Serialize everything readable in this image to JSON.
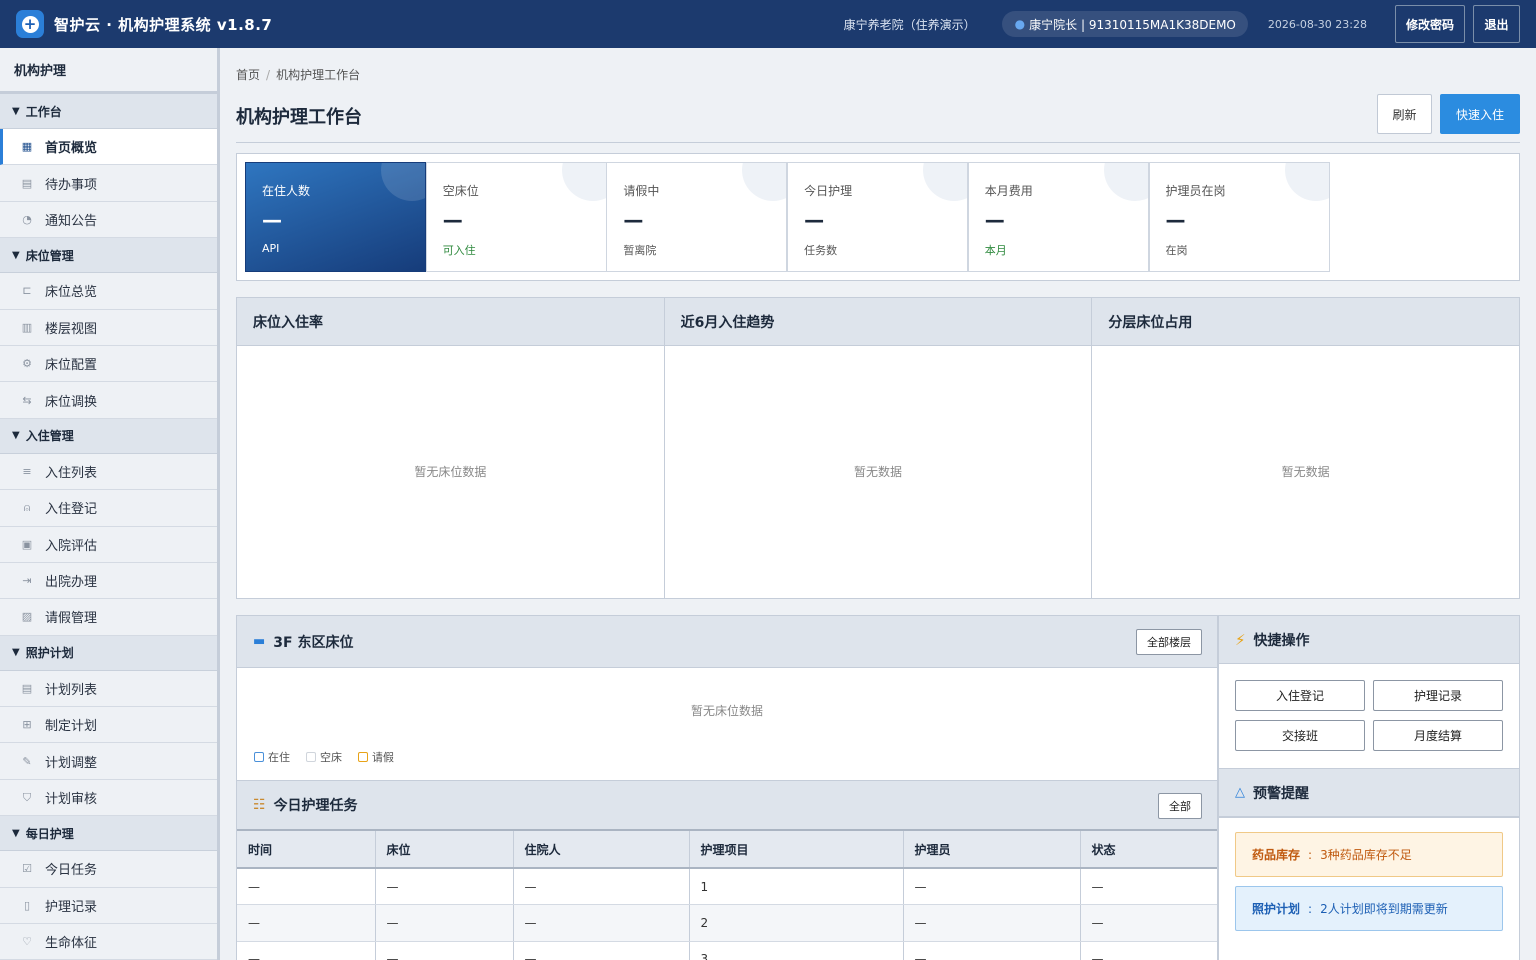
{
  "app": {
    "title": "智护云 · 机构护理系统 v1.8.7",
    "logo_glyph": "+"
  },
  "header": {
    "org": "康宁养老院（住养演示）",
    "user": "康宁院长 | 91310115MA1K38DEMO",
    "datetime": "2026-08-30 23:28",
    "change_password": "修改密码",
    "logout": "退出"
  },
  "sidebar": {
    "title": "机构护理",
    "groups": [
      {
        "label": "工作台",
        "items": [
          {
            "label": "首页概览",
            "icon": "grid-icon",
            "active": true
          },
          {
            "label": "待办事项",
            "icon": "clipboard-icon"
          },
          {
            "label": "通知公告",
            "icon": "bell-icon"
          }
        ]
      },
      {
        "label": "床位管理",
        "items": [
          {
            "label": "床位总览",
            "icon": "bed-icon"
          },
          {
            "label": "楼层视图",
            "icon": "building-icon"
          },
          {
            "label": "床位配置",
            "icon": "gear-icon"
          },
          {
            "label": "床位调换",
            "icon": "swap-icon"
          }
        ]
      },
      {
        "label": "入住管理",
        "items": [
          {
            "label": "入住列表",
            "icon": "list-icon"
          },
          {
            "label": "入住登记",
            "icon": "user-add-icon"
          },
          {
            "label": "入院评估",
            "icon": "check-clipboard-icon"
          },
          {
            "label": "出院办理",
            "icon": "exit-icon"
          },
          {
            "label": "请假管理",
            "icon": "calendar-off-icon"
          }
        ]
      },
      {
        "label": "照护计划",
        "items": [
          {
            "label": "计划列表",
            "icon": "clipboard-icon"
          },
          {
            "label": "制定计划",
            "icon": "file-plus-icon"
          },
          {
            "label": "计划调整",
            "icon": "pencil-icon"
          },
          {
            "label": "计划审核",
            "icon": "shield-icon"
          }
        ]
      },
      {
        "label": "每日护理",
        "items": [
          {
            "label": "今日任务",
            "icon": "check-square-icon"
          },
          {
            "label": "护理记录",
            "icon": "book-icon"
          },
          {
            "label": "生命体征",
            "icon": "heart-pulse-icon"
          }
        ]
      }
    ]
  },
  "breadcrumb": {
    "home": "首页",
    "sep": "/",
    "current": "机构护理工作台"
  },
  "page": {
    "title": "机构护理工作台",
    "refresh": "刷新",
    "quick_checkin": "快速入住"
  },
  "stats": [
    {
      "label": "在住人数",
      "value": "—",
      "sub": "API"
    },
    {
      "label": "空床位",
      "value": "—",
      "sub": "可入住"
    },
    {
      "label": "请假中",
      "value": "—",
      "sub": "暂离院"
    },
    {
      "label": "今日护理",
      "value": "—",
      "sub": "任务数"
    },
    {
      "label": "本月费用",
      "value": "—",
      "sub": "本月"
    },
    {
      "label": "护理员在岗",
      "value": "—",
      "sub": "在岗"
    }
  ],
  "charts": [
    {
      "title": "床位入住率",
      "empty": "暂无床位数据"
    },
    {
      "title": "近6月入住趋势",
      "empty": "暂无数据"
    },
    {
      "title": "分层床位占用",
      "empty": "暂无数据"
    }
  ],
  "beds": {
    "title": "3F 东区床位",
    "all_floors": "全部楼层",
    "empty": "暂无床位数据",
    "legend": [
      {
        "label": "在住",
        "color": "#4a90d9"
      },
      {
        "label": "空床",
        "color": "#d0d5dc"
      },
      {
        "label": "请假",
        "color": "#e8a317"
      }
    ]
  },
  "tasks": {
    "title": "今日护理任务",
    "all": "全部",
    "columns": [
      "时间",
      "床位",
      "住院人",
      "护理项目",
      "护理员",
      "状态"
    ],
    "rows": [
      [
        "—",
        "—",
        "—",
        "1",
        "—",
        "—"
      ],
      [
        "—",
        "—",
        "—",
        "2",
        "—",
        "—"
      ],
      [
        "—",
        "—",
        "—",
        "3",
        "—",
        "—"
      ]
    ]
  },
  "quick_ops": {
    "title": "快捷操作",
    "buttons": [
      "入住登记",
      "护理记录",
      "交接班",
      "月度结算"
    ]
  },
  "alerts": {
    "title": "预警提醒",
    "items": [
      {
        "tag": "药品库存",
        "text": "3种药品库存不足",
        "color": "#c05a10"
      },
      {
        "tag": "照护计划",
        "text": "2人计划即将到期需更新",
        "color": "#1c5fb4"
      }
    ]
  }
}
